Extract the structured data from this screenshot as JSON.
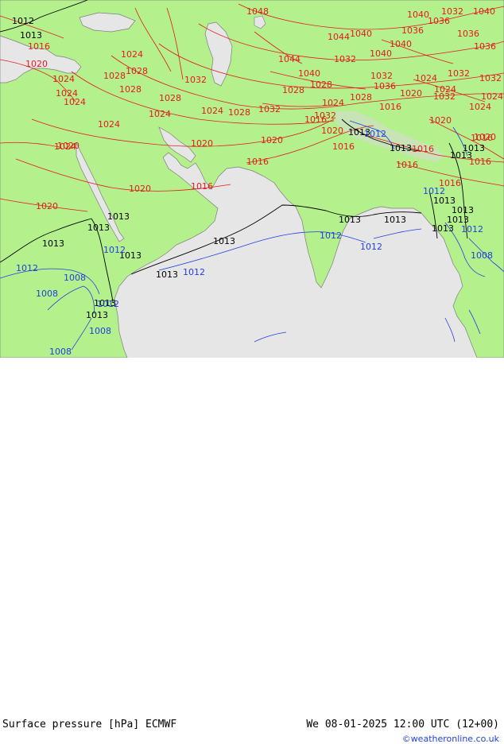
{
  "map": {
    "colors": {
      "land": "#b4f08c",
      "sea": "#e6e6e6",
      "high_terrain": "#d8d8d8",
      "isobar_high": "#e31a1c",
      "isobar_mid": "#000000",
      "isobar_low": "#1f3fe0",
      "coastline": "#7d7d7d"
    },
    "isobar_labels": {
      "red": [
        "1048",
        "1040",
        "1032",
        "1040",
        "1036",
        "1036",
        "1040",
        "1036",
        "1040",
        "1016",
        "1044",
        "1040",
        "1032",
        "1036",
        "1020",
        "1024",
        "1028",
        "1032",
        "1044",
        "1040",
        "1032",
        "1028",
        "1024",
        "1032",
        "1024",
        "1028",
        "1028",
        "1032",
        "1036",
        "1024",
        "1028",
        "1028",
        "1024",
        "1020",
        "1024",
        "1024",
        "1024",
        "1028",
        "1024",
        "1032",
        "1024",
        "1032",
        "1020",
        "1024",
        "1020",
        "1016",
        "1016",
        "1020",
        "1016",
        "1020",
        "1016",
        "1016",
        "1024",
        "1028",
        "1032",
        "1024",
        "1020",
        "1020",
        "1016",
        "1020",
        "1016",
        "1016",
        "1016",
        "1020",
        "1016"
      ],
      "black": [
        "1012",
        "1013",
        "1013",
        "1013",
        "1013",
        "1013",
        "1013",
        "1013",
        "1013",
        "1013",
        "1013",
        "1013",
        "1013",
        "1013",
        "1013",
        "1013",
        "1013",
        "1013",
        "1013",
        "1013"
      ],
      "blue": [
        "1012",
        "1012",
        "1008",
        "1008",
        "1012",
        "1008",
        "1012",
        "1012",
        "1012",
        "1012",
        "1012",
        "1008",
        "1012",
        "1008"
      ]
    }
  },
  "footer": {
    "title": "Surface pressure [hPa] ECMWF",
    "datetime": "We 08-01-2025 12:00 UTC (12+00)",
    "copyright": "©weatheronline.co.uk"
  }
}
